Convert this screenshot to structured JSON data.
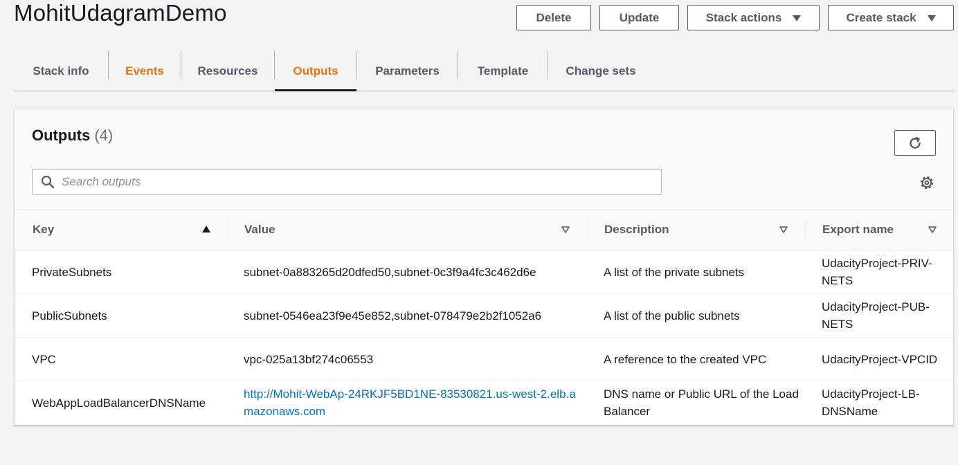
{
  "header": {
    "title": "MohitUdagramDemo",
    "buttons": {
      "delete": "Delete",
      "update": "Update",
      "stack_actions": "Stack actions",
      "create_stack": "Create stack"
    }
  },
  "tabs": [
    {
      "label": "Stack info",
      "state": "normal"
    },
    {
      "label": "Events",
      "state": "highlighted"
    },
    {
      "label": "Resources",
      "state": "normal"
    },
    {
      "label": "Outputs",
      "state": "active"
    },
    {
      "label": "Parameters",
      "state": "normal"
    },
    {
      "label": "Template",
      "state": "normal"
    },
    {
      "label": "Change sets",
      "state": "normal"
    }
  ],
  "outputs": {
    "title": "Outputs",
    "count": "(4)",
    "search_placeholder": "Search outputs",
    "columns": {
      "key": "Key",
      "value": "Value",
      "description": "Description",
      "export_name": "Export name"
    },
    "rows": [
      {
        "key": "PrivateSubnets",
        "value": "subnet-0a883265d20dfed50,subnet-0c3f9a4fc3c462d6e",
        "description": "A list of the private subnets",
        "export_name": "UdacityProject-PRIV-NETS"
      },
      {
        "key": "PublicSubnets",
        "value": "subnet-0546ea23f9e45e852,subnet-078479e2b2f1052a6",
        "description": "A list of the public subnets",
        "export_name": "UdacityProject-PUB-NETS"
      },
      {
        "key": "VPC",
        "value": "vpc-025a13bf274c06553",
        "description": "A reference to the created VPC",
        "export_name": "UdacityProject-VPCID"
      },
      {
        "key": "WebAppLoadBalancerDNSName",
        "value": "http://Mohit-WebAp-24RKJF5BD1NE-83530821.us-west-2.elb.amazonaws.com",
        "description": "DNS name or Public URL of the Load Balancer",
        "export_name": "UdacityProject-LB-DNSName"
      }
    ]
  },
  "colors": {
    "accent_orange": "#ec7211",
    "link_blue": "#0073bb",
    "text_dark": "#16191f",
    "text_gray": "#545b64"
  },
  "icons": [
    "caret-down-icon",
    "refresh-icon",
    "search-icon",
    "gear-icon",
    "sort-ascending-icon",
    "sort-filter-icon"
  ]
}
